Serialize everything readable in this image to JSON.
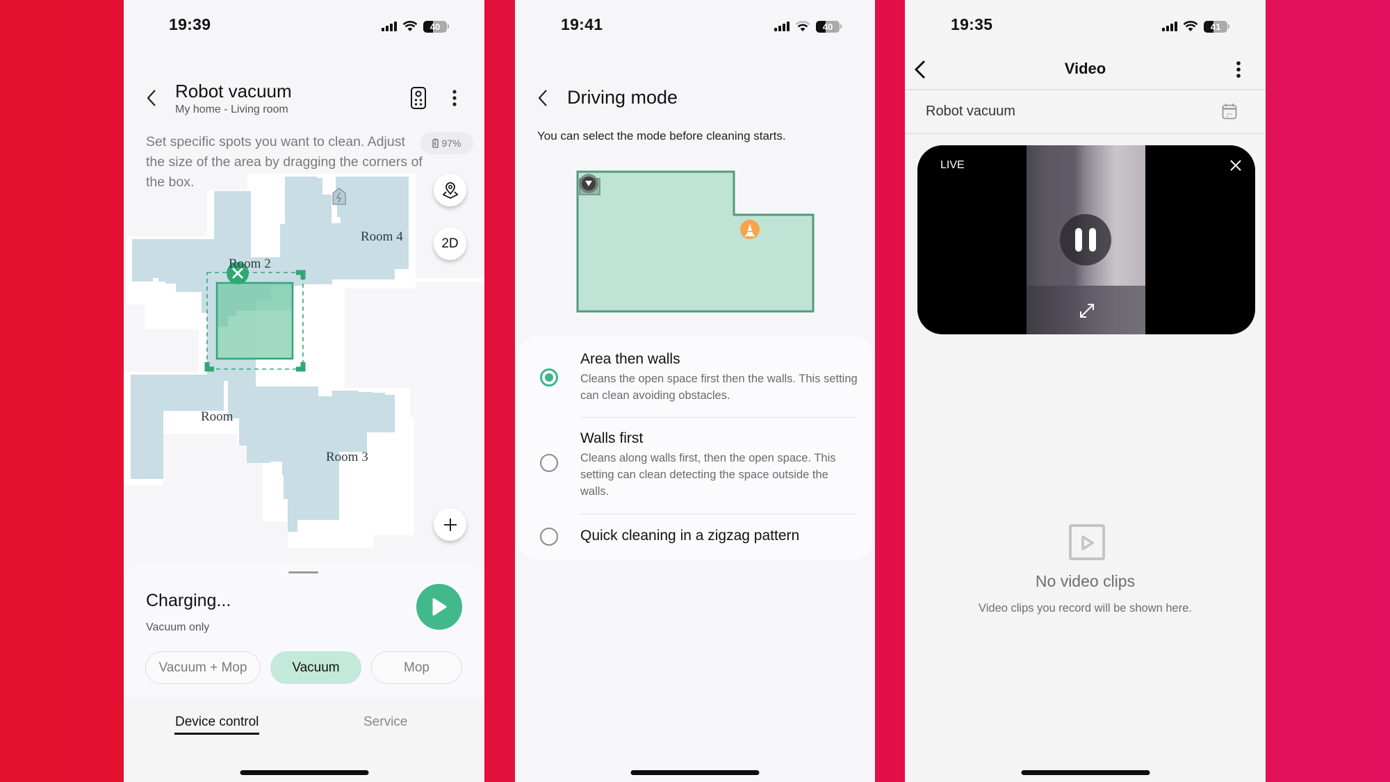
{
  "colors": {
    "accent_green": "#43b88a",
    "map_fill": "#c8dde4",
    "background_red": "#e3102f",
    "background_pink": "#e2105c",
    "cone_orange": "#f7a44a"
  },
  "panels": [
    {
      "status": {
        "time": "19:39",
        "battery": "40",
        "battery_level": 0.4
      },
      "header": {
        "title": "Robot vacuum",
        "subtitle": "My home - Living room",
        "back_icon": "chevron-left-icon",
        "remote_icon": "remote-control-icon",
        "more_icon": "more-vertical-icon"
      },
      "description": "Set specific spots you want to clean. Adjust the size of the area by dragging the corners of the box.",
      "battery_pill": "97%",
      "map": {
        "rooms": [
          "Room 4",
          "Room 2",
          "Room",
          "Room 3"
        ],
        "buttons": {
          "locate_icon": "location-map-icon",
          "view_mode": "2D",
          "zoom_icon": "plus-icon"
        },
        "dock_icon": "charging-dock-icon",
        "zone_remove_icon": "close-icon"
      },
      "sheet": {
        "status": "Charging...",
        "mode": "Vacuum only",
        "play_icon": "play-icon",
        "chips": [
          {
            "label": "Vacuum + Mop",
            "active": false
          },
          {
            "label": "Vacuum",
            "active": true
          },
          {
            "label": "Mop",
            "active": false
          }
        ]
      },
      "tabs": [
        {
          "label": "Device control",
          "active": true
        },
        {
          "label": "Service",
          "active": false
        }
      ]
    },
    {
      "status": {
        "time": "19:41",
        "battery": "40",
        "battery_level": 0.4
      },
      "header": {
        "title": "Driving mode",
        "back_icon": "chevron-left-icon"
      },
      "description": "You can select the mode before cleaning starts.",
      "map": {
        "robot_icon": "robot-position-icon",
        "obstacle_icon": "traffic-cone-icon"
      },
      "options": [
        {
          "title": "Area then walls",
          "description": "Cleans the open space first then the walls. This setting can clean avoiding obstacles.",
          "selected": true
        },
        {
          "title": "Walls first",
          "description": "Cleans along walls first, then the open space. This setting can clean detecting the space outside the walls.",
          "selected": false
        },
        {
          "title": "Quick cleaning in a zigzag pattern",
          "description": "",
          "selected": false
        }
      ]
    },
    {
      "status": {
        "time": "19:35",
        "battery": "41",
        "battery_level": 0.41
      },
      "header": {
        "title": "Video",
        "back_icon": "chevron-left-icon",
        "more_icon": "more-vertical-icon"
      },
      "device_name": "Robot vacuum",
      "calendar_icon": "calendar-icon",
      "video": {
        "live_label": "LIVE",
        "close_icon": "close-icon",
        "pause_icon": "pause-icon",
        "expand_icon": "expand-icon"
      },
      "empty_state": {
        "icon": "video-clip-icon",
        "title": "No video clips",
        "subtitle": "Video clips you record will be shown here."
      }
    }
  ]
}
